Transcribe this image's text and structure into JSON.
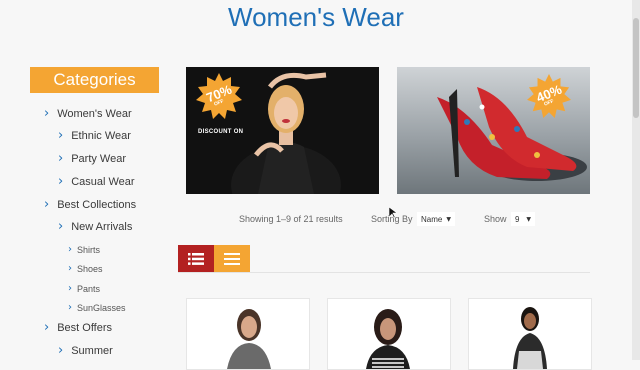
{
  "page": {
    "title": "Women's Wear"
  },
  "sidebar": {
    "header": "Categories",
    "items": [
      {
        "label": "Women's Wear"
      },
      {
        "label": "Ethnic Wear"
      },
      {
        "label": "Party Wear"
      },
      {
        "label": "Casual Wear"
      },
      {
        "label": "Best Collections"
      },
      {
        "label": "New Arrivals"
      },
      {
        "label": "Shirts"
      },
      {
        "label": "Shoes"
      },
      {
        "label": "Pants"
      },
      {
        "label": "SunGlasses"
      },
      {
        "label": "Best Offers"
      },
      {
        "label": "Summer"
      }
    ]
  },
  "banners": [
    {
      "badge": "70%",
      "badge_sub": "OFF",
      "caption": "DISCOUNT ON"
    },
    {
      "badge": "40%",
      "badge_sub": "OFF"
    }
  ],
  "toolbar": {
    "results_text": "Showing 1–9 of 21 results",
    "sort_label": "Sorting By",
    "sort_value": "Name",
    "show_label": "Show",
    "show_value": "9"
  },
  "colors": {
    "accent_orange": "#f4a533",
    "accent_red": "#b32121",
    "title_blue": "#1f6fb6"
  },
  "icons": {
    "list_view": "list-icon",
    "grid_view": "menu-lines-icon",
    "nav": "chevron-right-icon"
  }
}
